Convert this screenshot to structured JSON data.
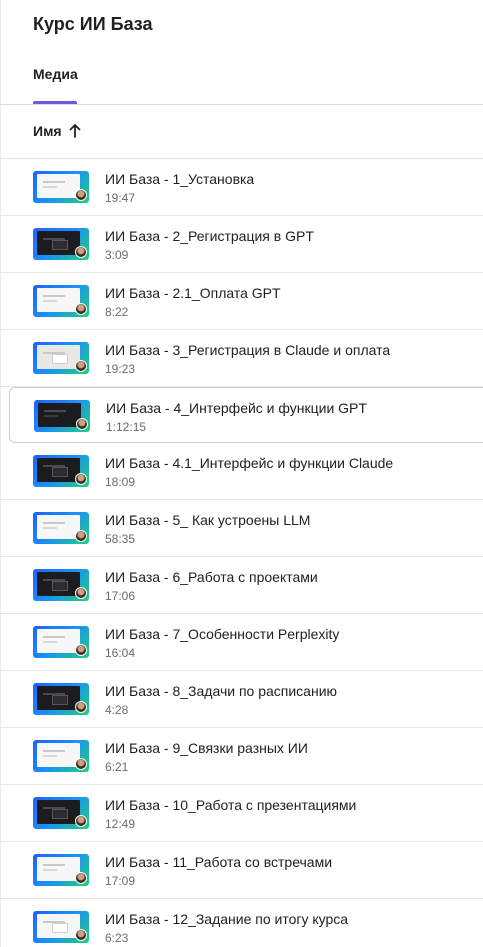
{
  "app": {
    "title": "Курс ИИ База"
  },
  "tabs": [
    {
      "label": "Медиа",
      "active": true
    }
  ],
  "sort": {
    "label": "Имя",
    "direction": "ascending",
    "icon": "arrow-up-icon"
  },
  "colors": {
    "accent": "#6a5ae0",
    "thumb_gradient_start": "#1e63ff",
    "thumb_gradient_end": "#21d07a"
  },
  "items": [
    {
      "title": "ИИ База - 1_Установка",
      "duration": "19:47",
      "thumb": "light"
    },
    {
      "title": "ИИ База - 2_Регистрация в GPT",
      "duration": "3:09",
      "thumb": "dark"
    },
    {
      "title": "ИИ База - 2.1_Оплата GPT",
      "duration": "8:22",
      "thumb": "light"
    },
    {
      "title": "ИИ База - 3_Регистрация в Claude и оплата",
      "duration": "19:23",
      "thumb": "gray"
    },
    {
      "title": "ИИ База - 4_Интерфейс и функции GPT",
      "duration": "1:12:15",
      "thumb": "dark",
      "selected": true
    },
    {
      "title": "ИИ База - 4.1_Интерфейс и функции Claude",
      "duration": "18:09",
      "thumb": "dark"
    },
    {
      "title": "ИИ База - 5_ Как устроены LLM",
      "duration": "58:35",
      "thumb": "light"
    },
    {
      "title": "ИИ База - 6_Работа с проектами",
      "duration": "17:06",
      "thumb": "dark"
    },
    {
      "title": "ИИ База - 7_Особенности Perplexity",
      "duration": "16:04",
      "thumb": "light"
    },
    {
      "title": "ИИ База - 8_Задачи по расписанию",
      "duration": "4:28",
      "thumb": "dark"
    },
    {
      "title": "ИИ База - 9_Связки разных ИИ",
      "duration": "6:21",
      "thumb": "light"
    },
    {
      "title": "ИИ База - 10_Работа с презентациями",
      "duration": "12:49",
      "thumb": "dark"
    },
    {
      "title": "ИИ База - 11_Работа со встречами",
      "duration": "17:09",
      "thumb": "light"
    },
    {
      "title": "ИИ База - 12_Задание по итогу курса",
      "duration": "6:23",
      "thumb": "light"
    }
  ]
}
